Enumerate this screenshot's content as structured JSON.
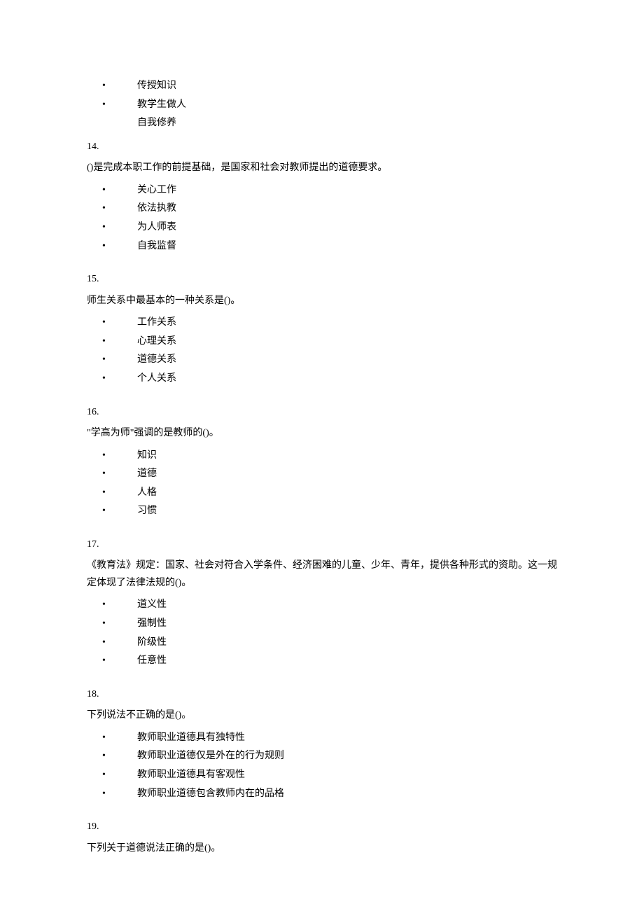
{
  "preamble_options": [
    {
      "text": "传授知识",
      "bullet": true
    },
    {
      "text": "教学生做人",
      "bullet": true
    },
    {
      "text": "自我修养",
      "bullet": false
    }
  ],
  "questions": [
    {
      "number": "14.",
      "text": "()是完成本职工作的前提基础，是国家和社会对教师提出的道德要求。",
      "options": [
        "关心工作",
        "依法执教",
        "为人师表",
        "自我监督"
      ]
    },
    {
      "number": "15.",
      "text": "师生关系中最基本的一种关系是()。",
      "options": [
        "工作关系",
        "心理关系",
        "道德关系",
        "个人关系"
      ]
    },
    {
      "number": "16.",
      "text": "\"学高为师\"强调的是教师的()。",
      "options": [
        "知识",
        "道德",
        "人格",
        "习惯"
      ]
    },
    {
      "number": "17.",
      "text": "《教育法》规定：国家、社会对符合入学条件、经济困难的儿童、少年、青年，提供各种形式的资助。这一规定体现了法律法规的()。",
      "options": [
        "道义性",
        "强制性",
        "阶级性",
        "任意性"
      ]
    },
    {
      "number": "18.",
      "text": "下列说法不正确的是()。",
      "options": [
        "教师职业道德具有独特性",
        "教师职业道德仅是外在的行为规则",
        "教师职业道德具有客观性",
        "教师职业道德包含教师内在的品格"
      ]
    },
    {
      "number": "19.",
      "text": "下列关于道德说法正确的是()。",
      "options": []
    }
  ]
}
